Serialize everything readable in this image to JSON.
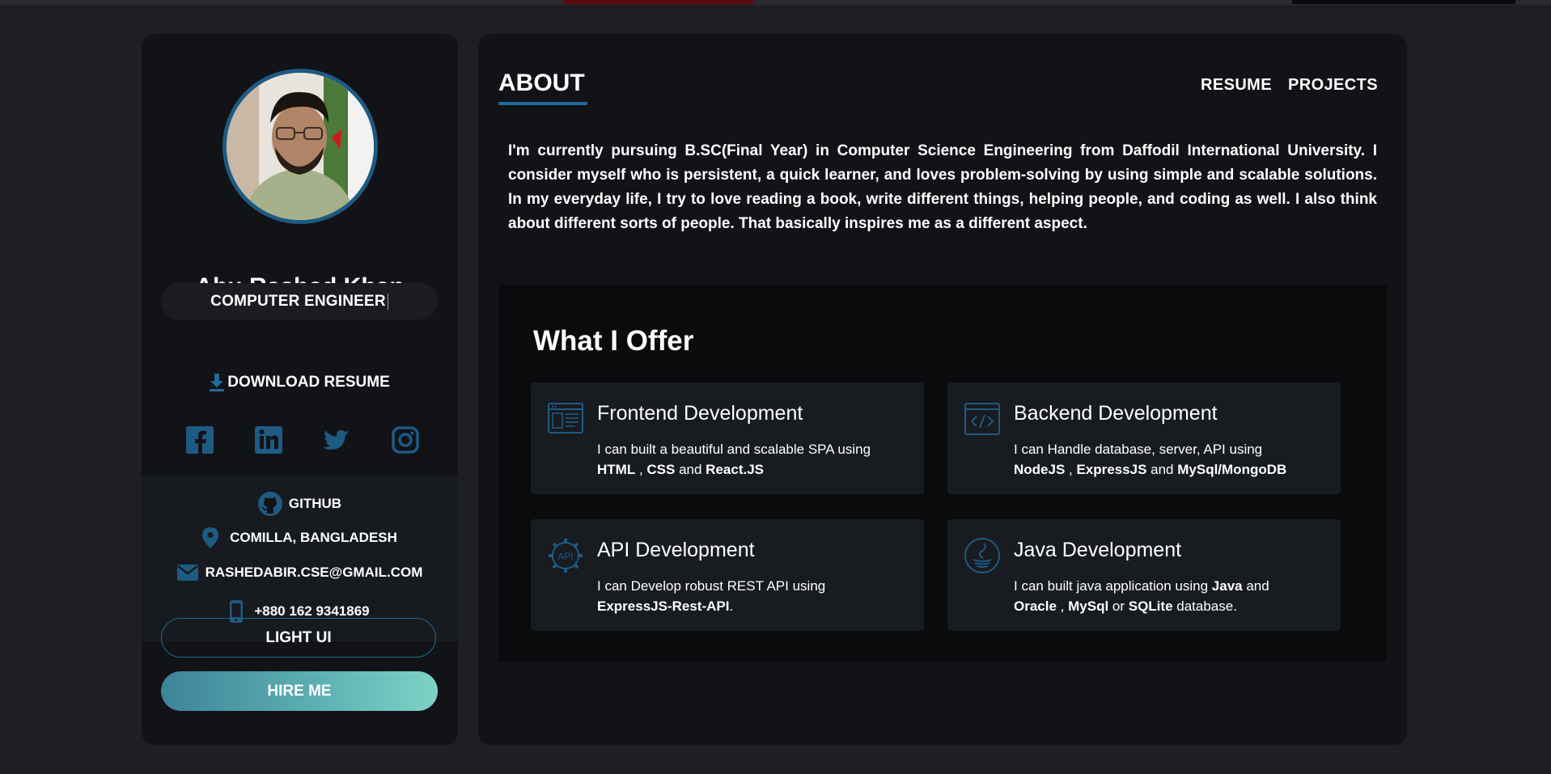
{
  "profile": {
    "name": "Abu Rashed Khan",
    "role": "COMPUTER ENGINEER",
    "download_label": "DOWNLOAD RESUME",
    "socials": [
      "facebook-icon",
      "linkedin-icon",
      "twitter-icon",
      "instagram-icon"
    ],
    "contact": {
      "github": "GITHUB",
      "location": "COMILLA, BANGLADESH",
      "email": "RASHEDABIR.CSE@GMAIL.COM",
      "phone": "+880 162 9341869"
    },
    "light_ui_label": "LIGHT UI",
    "hire_label": "HIRE ME"
  },
  "main": {
    "title": "ABOUT",
    "nav": [
      "RESUME",
      "PROJECTS"
    ],
    "about": "I'm currently pursuing B.SC(Final Year) in Computer Science Engineering from Daffodil International University. I consider myself who is persistent, a quick learner, and loves problem-solving by using simple and scalable solutions. In my everyday life, I try to love reading a book, write different things, helping people, and coding as well. I also think about different sorts of people. That basically inspires me as a different aspect."
  },
  "offer": {
    "title": "What I Offer",
    "cards": [
      {
        "title": "Frontend Development",
        "desc_prefix": "I can built a beautiful and scalable SPA using",
        "t1": "HTML",
        "s1": " , ",
        "t2": "CSS",
        "s2": " and ",
        "t3": "React.JS",
        "s3": ""
      },
      {
        "title": "Backend Development",
        "desc_prefix": "I can Handle database, server, API using",
        "t1": "NodeJS",
        "s1": " , ",
        "t2": "ExpressJS",
        "s2": " and ",
        "t3": "MySql/MongoDB",
        "s3": ""
      },
      {
        "title": "API Development",
        "desc_prefix": "I can Develop robust REST API using",
        "t1": "ExpressJS-Rest-API",
        "s1": ".",
        "t2": "",
        "s2": "",
        "t3": "",
        "s3": ""
      },
      {
        "title": "Java Development",
        "desc_prefix": "I can built java application using",
        "desc_bold_inline": "Java",
        "desc_inline_after": " and",
        "t1": "Oracle",
        "s1": " , ",
        "t2": "MySql",
        "s2": " or ",
        "t3": "SQLite",
        "s3": " database."
      }
    ]
  },
  "colors": {
    "background": "#1e1f23",
    "panel": "#111317",
    "accent": "#1e5a82",
    "hire_gradient_start": "#3d8398",
    "hire_gradient_end": "#7fd2c6"
  }
}
